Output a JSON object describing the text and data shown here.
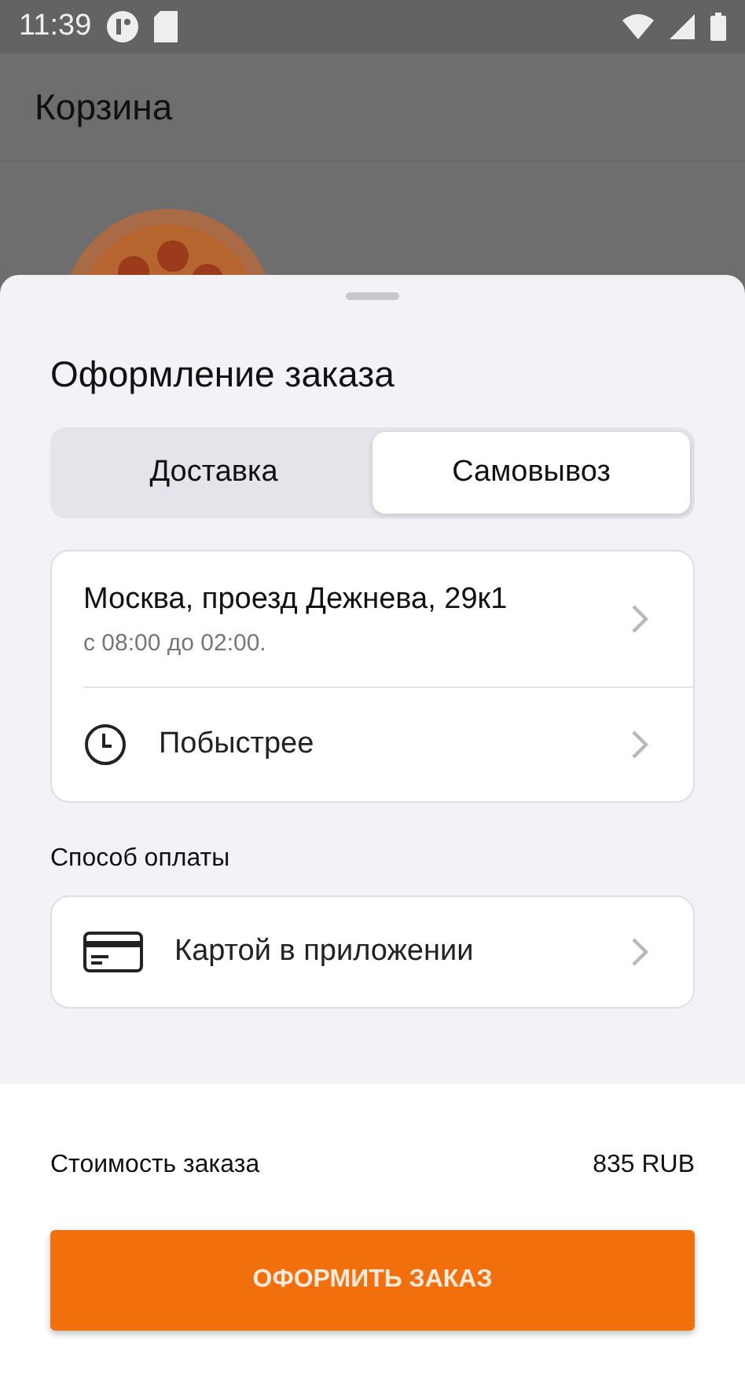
{
  "status_bar": {
    "time": "11:39"
  },
  "background": {
    "title": "Корзина"
  },
  "sheet": {
    "title": "Оформление заказа",
    "tabs": [
      {
        "label": "Доставка",
        "selected": false
      },
      {
        "label": "Самовывоз",
        "selected": true
      }
    ],
    "address": {
      "title": "Москва, проезд Дежнева, 29к1",
      "hours": "с 08:00 до 02:00."
    },
    "time_option": "Побыстрее",
    "payment_label": "Способ оплаты",
    "payment_option": "Картой в приложении",
    "total_label": "Стоимость заказа",
    "total_value": "835 RUB",
    "submit": "ОФОРМИТЬ ЗАКАЗ"
  }
}
